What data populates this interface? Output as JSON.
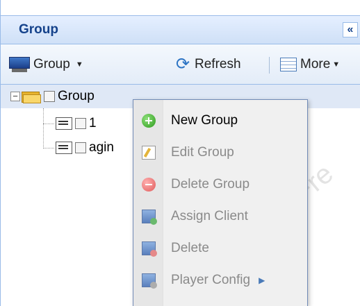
{
  "panel": {
    "title": "Group",
    "collapse_icon": "«"
  },
  "toolbar": {
    "group_label": "Group",
    "refresh_label": "Refresh",
    "more_label": "More",
    "caret": "▼"
  },
  "tree": {
    "root": {
      "label": "Group",
      "expander": "−"
    },
    "children": [
      {
        "label": "1"
      },
      {
        "label": "agin"
      }
    ]
  },
  "context_menu": {
    "items": [
      {
        "label": "New Group",
        "icon": "add-circle-icon",
        "enabled": true
      },
      {
        "label": "Edit Group",
        "icon": "edit-icon",
        "enabled": false
      },
      {
        "label": "Delete Group",
        "icon": "remove-circle-icon",
        "enabled": false
      },
      {
        "label": "Assign Client",
        "icon": "assign-client-icon",
        "enabled": false
      },
      {
        "label": "Delete",
        "icon": "delete-client-icon",
        "enabled": false
      },
      {
        "label": "Player Config",
        "icon": "player-config-icon",
        "enabled": false,
        "submenu_arrow": "▶"
      }
    ]
  },
  "colors": {
    "title_text": "#15428b",
    "border": "#99bbe8",
    "menu_bg": "#f0f0f0",
    "disabled_text": "#8a8a8a"
  }
}
